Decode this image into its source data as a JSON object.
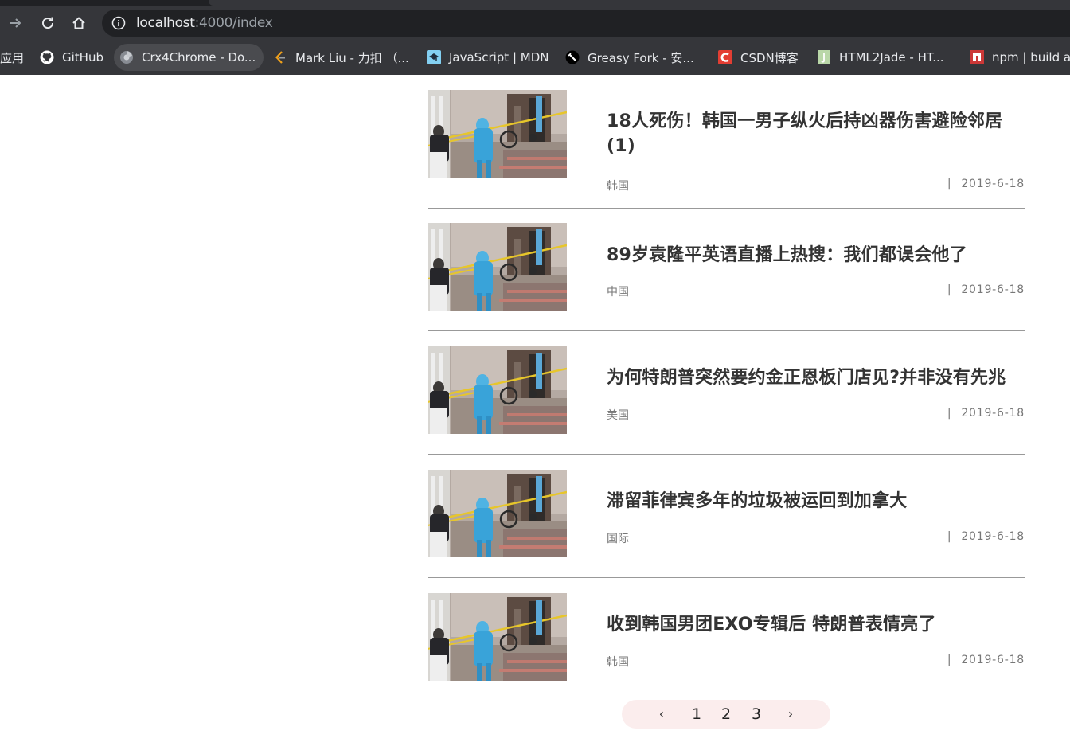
{
  "browser": {
    "url_host": "localhost",
    "url_path": ":4000/index",
    "bookmarks": [
      {
        "label": "应用",
        "icon": "apps-icon"
      },
      {
        "label": "GitHub",
        "icon": "github-icon"
      },
      {
        "label": "Crx4Chrome - Do...",
        "icon": "crx4chrome-icon"
      },
      {
        "label": "Mark Liu - 力扣 （...",
        "icon": "leetcode-icon"
      },
      {
        "label": "JavaScript | MDN",
        "icon": "mdn-icon"
      },
      {
        "label": "Greasy Fork - 安...",
        "icon": "greasyfork-icon"
      },
      {
        "label": "CSDN博客",
        "icon": "csdn-icon"
      },
      {
        "label": "HTML2Jade - HT...",
        "icon": "html2jade-icon"
      },
      {
        "label": "npm | build a",
        "icon": "npm-icon"
      }
    ]
  },
  "news": [
    {
      "title": "18人死伤！韩国一男子纵火后持凶器伤害避险邻居(1)",
      "tag": "韩国",
      "date": "2019-6-18"
    },
    {
      "title": "89岁袁隆平英语直播上热搜：我们都误会他了",
      "tag": "中国",
      "date": "2019-6-18"
    },
    {
      "title": "为何特朗普突然要约金正恩板门店见?并非没有先兆",
      "tag": "美国",
      "date": "2019-6-18"
    },
    {
      "title": "滞留菲律宾多年的垃圾被运回到加拿大",
      "tag": "国际",
      "date": "2019-6-18"
    },
    {
      "title": "收到韩国男团EXO专辑后 特朗普表情亮了",
      "tag": "韩国",
      "date": "2019-6-18"
    }
  ],
  "date_separator": "|",
  "pagination": {
    "prev": "‹",
    "pages": [
      "1",
      "2",
      "3"
    ],
    "next": "›"
  },
  "colors": {
    "chrome_bg": "#35363a",
    "omnibox_bg": "#202124",
    "title_text": "#333333",
    "meta_text": "#777777",
    "divider": "#999999",
    "pager_bg": "#fbeded"
  }
}
